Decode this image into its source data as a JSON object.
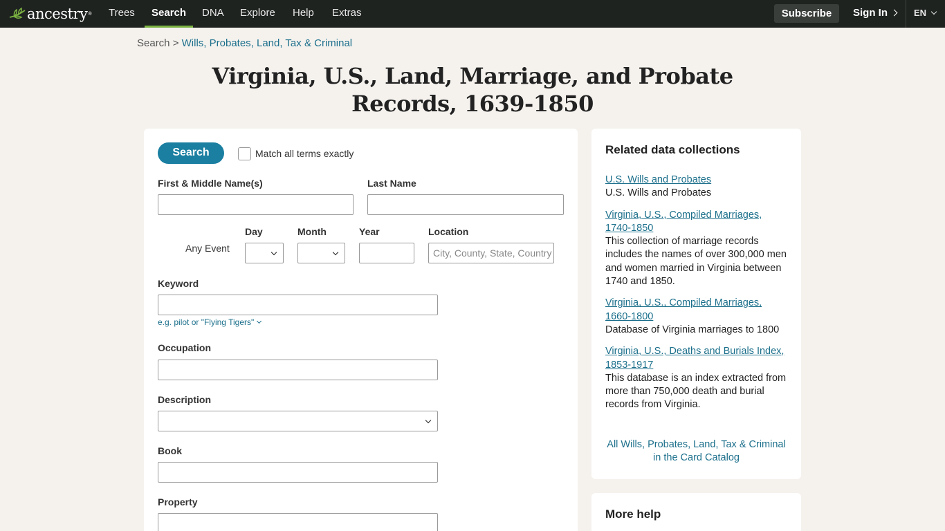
{
  "nav": {
    "logo_text": "ancestry",
    "logo_tm": "®",
    "items": [
      "Trees",
      "Search",
      "DNA",
      "Explore",
      "Help",
      "Extras"
    ],
    "active_item": "Search",
    "subscribe": "Subscribe",
    "sign_in": "Sign In",
    "language": "EN"
  },
  "breadcrumb": {
    "root": "Search",
    "sep": ">",
    "current": "Wills, Probates, Land, Tax & Criminal"
  },
  "page_title_line1": "Virginia, U.S., Land, Marriage, and Probate",
  "page_title_line2": "Records, 1639-1850",
  "form": {
    "search_button": "Search",
    "match_exact_label": "Match all terms exactly",
    "first_name_label": "First & Middle Name(s)",
    "last_name_label": "Last Name",
    "any_event_label": "Any Event",
    "day_label": "Day",
    "month_label": "Month",
    "year_label": "Year",
    "location_label": "Location",
    "location_placeholder": "City, County, State, Country",
    "keyword_label": "Keyword",
    "keyword_hint": "e.g. pilot or \"Flying Tigers\"",
    "occupation_label": "Occupation",
    "description_label": "Description",
    "book_label": "Book",
    "property_label": "Property"
  },
  "related": {
    "title": "Related data collections",
    "items": [
      {
        "link": "U.S. Wills and Probates",
        "desc": "U.S. Wills and Probates"
      },
      {
        "link": "Virginia, U.S., Compiled Marriages, 1740-1850",
        "desc": "This collection of marriage records includes the names of over 300,000 men and women married in Virginia between 1740 and 1850."
      },
      {
        "link": "Virginia, U.S., Compiled Marriages, 1660-1800",
        "desc": "Database of Virginia marriages to 1800"
      },
      {
        "link": "Virginia, U.S., Deaths and Burials Index, 1853-1917",
        "desc": "This database is an index extracted from more than 750,000 death and burial records from Virginia."
      }
    ],
    "footer_link": "All Wills, Probates, Land, Tax & Criminal in the Card Catalog"
  },
  "help": {
    "title": "More help"
  },
  "colors": {
    "nav_bg": "#1f2320",
    "accent_green": "#7bb241",
    "button_blue": "#1a7fa1",
    "link_blue": "#1b6f8b",
    "page_bg": "#f5f2ee"
  }
}
